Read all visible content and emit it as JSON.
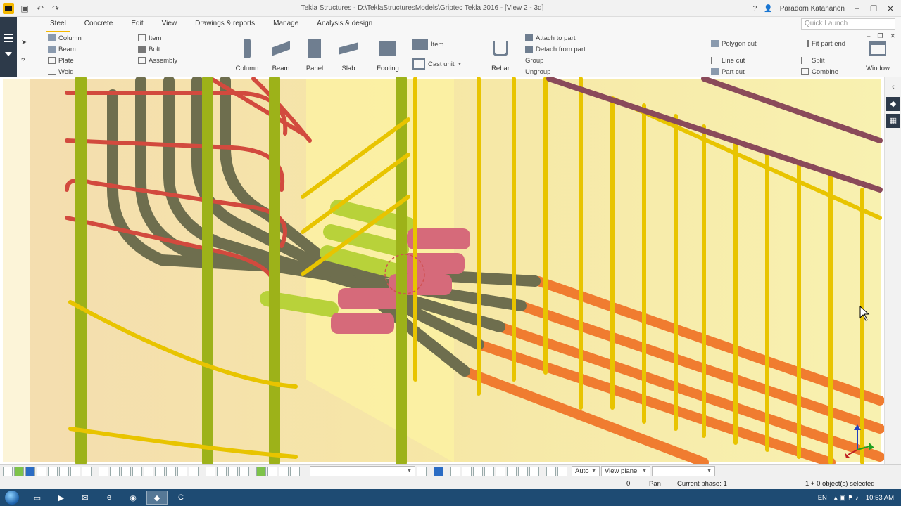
{
  "window": {
    "title": "Tekla Structures - D:\\TeklaStructuresModels\\Griptec Tekla 2016 - [View 2 - 3d]",
    "help": "?",
    "user": "Paradorn Katananon"
  },
  "quick_access": {
    "icons": [
      "app-logo",
      "save-icon",
      "undo-icon",
      "redo-icon"
    ]
  },
  "ribbon": {
    "tabs": [
      "Steel",
      "Concrete",
      "Edit",
      "View",
      "Drawings & reports",
      "Manage",
      "Analysis & design"
    ],
    "active_tab": "Steel",
    "quick_launch_placeholder": "Quick Launch",
    "steel_items": [
      "Column",
      "Beam",
      "Plate",
      "Weld"
    ],
    "steel_items2": [
      "Item",
      "Bolt",
      "Assembly"
    ],
    "concrete_buttons": [
      "Column",
      "Beam",
      "Panel",
      "Slab",
      "Footing"
    ],
    "item_label": "Item",
    "cast_unit_label": "Cast unit",
    "rebar_label": "Rebar",
    "group_items": [
      "Attach to part",
      "Detach from part",
      "Group",
      "Ungroup"
    ],
    "cut_items": [
      "Polygon cut",
      "Line cut",
      "Part cut"
    ],
    "edit_items": [
      "Fit part end",
      "Split",
      "Combine"
    ],
    "window_label": "Window"
  },
  "toolbar": {
    "auto": "Auto",
    "view_plane": "View plane"
  },
  "status": {
    "zero": "0",
    "pan": "Pan",
    "phase": "Current phase: 1",
    "selected": "1 + 0 object(s) selected"
  },
  "taskbar": {
    "lang": "EN",
    "time": "10:53 AM"
  },
  "colors": {
    "accent": "#f5b800",
    "rebar_yellow": "#e8c400",
    "rebar_green": "#9db219",
    "rebar_red": "#d24a3e",
    "coupler_pink": "#d66a7a",
    "pipe_olive": "#6e6e4e",
    "bar_orange": "#f07c30"
  }
}
